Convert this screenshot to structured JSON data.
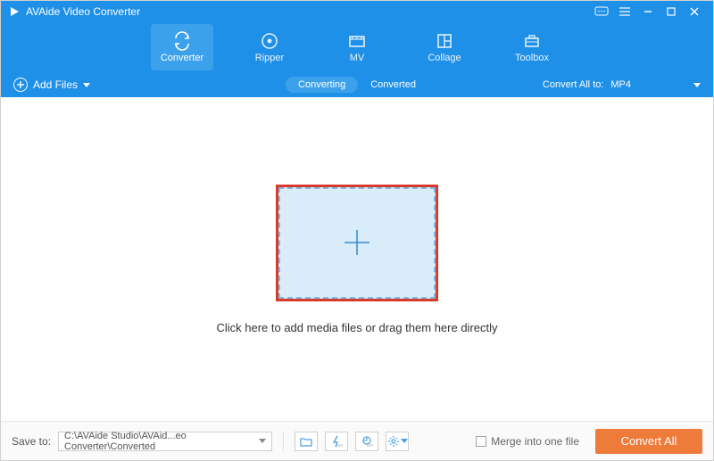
{
  "app": {
    "title": "AVAide Video Converter"
  },
  "nav": {
    "converter": "Converter",
    "ripper": "Ripper",
    "mv": "MV",
    "collage": "Collage",
    "toolbox": "Toolbox"
  },
  "toolbar": {
    "add_files": "Add Files",
    "tab_converting": "Converting",
    "tab_converted": "Converted",
    "convert_all_to_label": "Convert All to:",
    "format": "MP4"
  },
  "main": {
    "hint": "Click here to add media files or drag them here directly"
  },
  "bottom": {
    "save_to_label": "Save to:",
    "path": "C:\\AVAide Studio\\AVAid...eo Converter\\Converted",
    "merge_label": "Merge into one file",
    "convert_all": "Convert All"
  }
}
